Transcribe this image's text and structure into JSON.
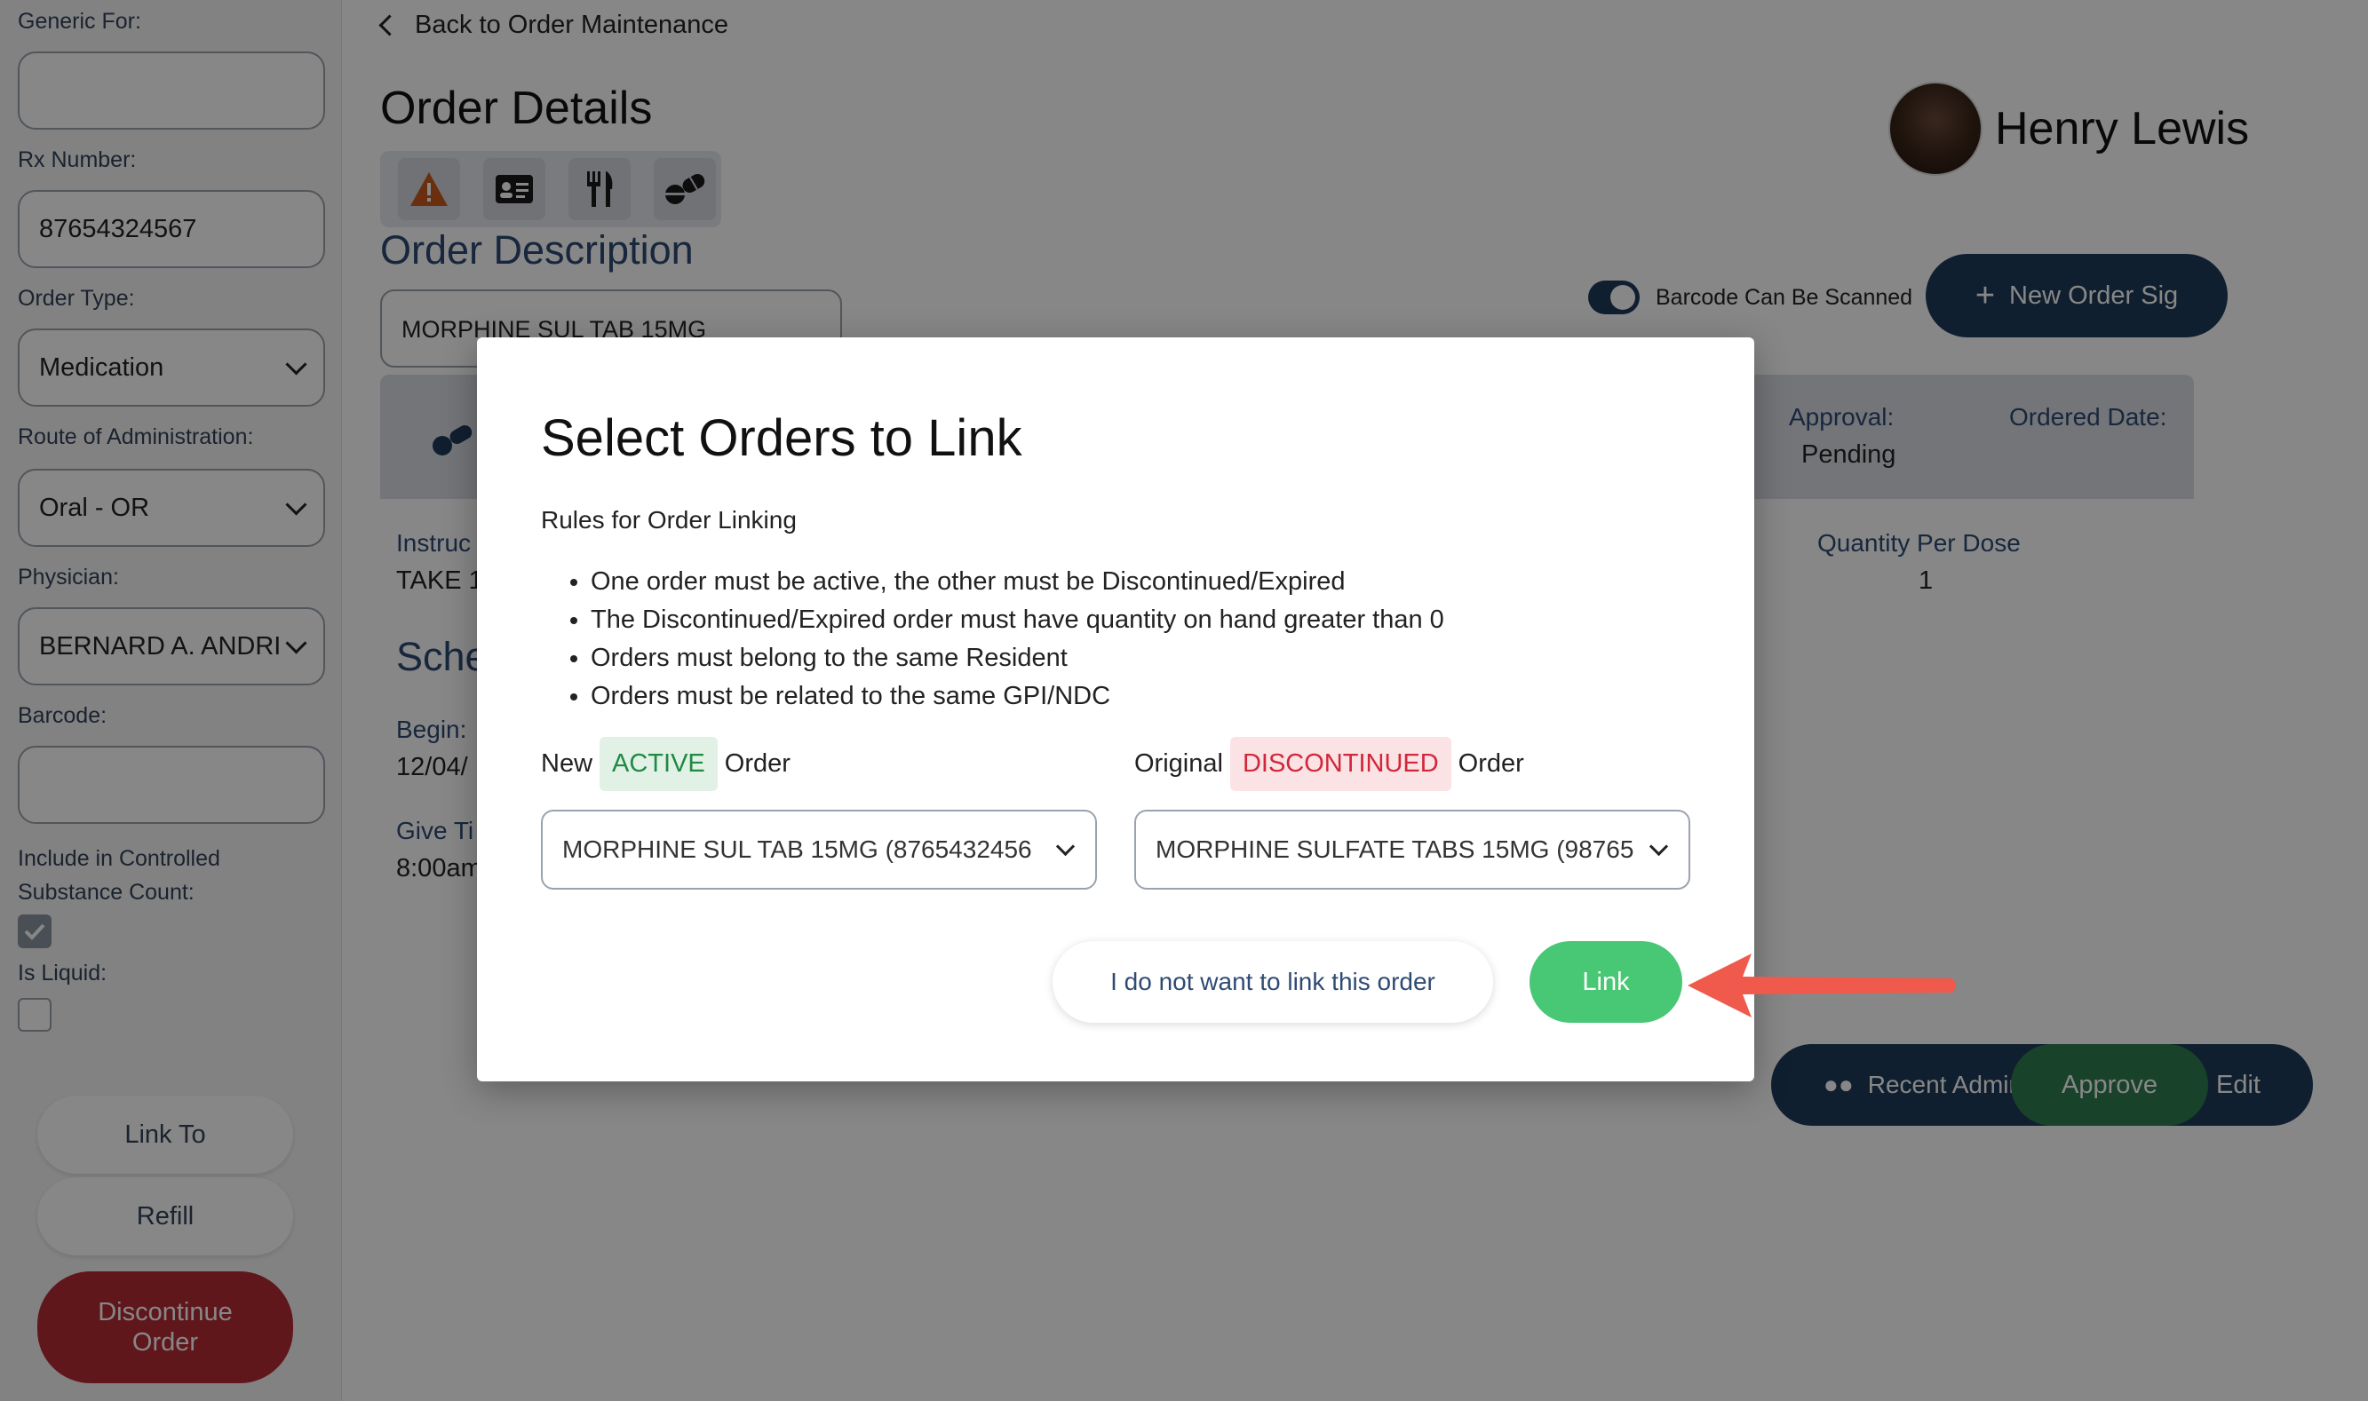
{
  "sidebar": {
    "generic_for_label": "Generic For:",
    "generic_for_value": "",
    "rx_number_label": "Rx Number:",
    "rx_number_value": "87654324567",
    "order_type_label": "Order Type:",
    "order_type_value": "Medication",
    "route_label": "Route of Administration:",
    "route_value": "Oral - OR",
    "physician_label": "Physician:",
    "physician_value": "BERNARD A. ANDRI",
    "barcode_label": "Barcode:",
    "barcode_value": "",
    "controlled_label": "Include in Controlled Substance Count:",
    "controlled_checked": true,
    "liquid_label": "Is Liquid:",
    "liquid_checked": false,
    "link_to_label": "Link To",
    "refill_label": "Refill",
    "discontinue_label_1": "Discontinue",
    "discontinue_label_2": "Order"
  },
  "header": {
    "back_label": "Back to Order Maintenance",
    "page_title": "Order Details",
    "section_title": "Order Description",
    "order_description": "MORPHINE SUL TAB 15MG",
    "patient_name": "Henry Lewis",
    "barcode_toggle_label": "Barcode Can Be Scanned",
    "new_order_sig_label": "New Order Sig",
    "icons": [
      "warning-icon",
      "id-card-icon",
      "utensils-icon",
      "pills-icon"
    ]
  },
  "card": {
    "approval_label": "Approval:",
    "approval_value": "Pending",
    "ordered_date_label": "Ordered Date:",
    "instructions_label": "Instruc",
    "instructions_value": "TAKE 1",
    "schedule_title": "Sche",
    "begin_label": "Begin:",
    "begin_value": "12/04/",
    "give_time_label": "Give Ti",
    "give_time_value": "8:00am",
    "quantity_label": "Quantity Per Dose",
    "quantity_value": "1",
    "recent_admins_label": "Recent Admins",
    "edit_label": "Edit",
    "approve_label": "Approve"
  },
  "modal": {
    "title": "Select Orders to Link",
    "subtitle": "Rules for Order Linking",
    "rules": [
      "One order must be active, the other must be Discontinued/Expired",
      "The Discontinued/Expired order must have quantity on hand greater than 0",
      "Orders must belong to the same Resident",
      "Orders must be related to the same GPI/NDC"
    ],
    "new_prefix": "New",
    "active_badge": "ACTIVE",
    "order_word": "Order",
    "original_prefix": "Original",
    "discontinued_badge": "DISCONTINUED",
    "new_order_select": "MORPHINE SUL TAB 15MG (8765432456",
    "original_order_select": "MORPHINE SULFATE TABS 15MG (98765",
    "decline_label": "I do not want to link this order",
    "link_label": "Link"
  },
  "colors": {
    "primary": "#1f3b5a",
    "success": "#48c774",
    "danger": "#b52d35",
    "callout": "#ef5a4c"
  }
}
